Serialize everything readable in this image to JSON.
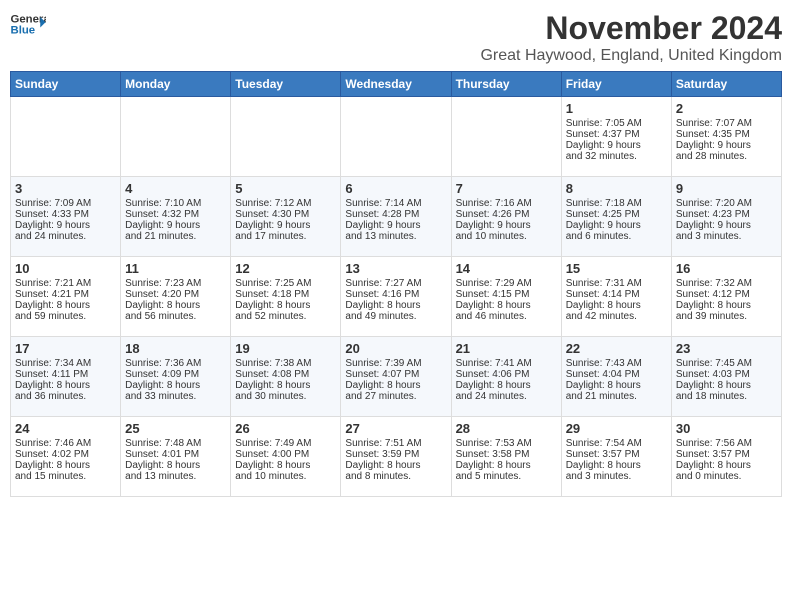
{
  "logo": {
    "line1": "General",
    "line2": "Blue"
  },
  "title": "November 2024",
  "location": "Great Haywood, England, United Kingdom",
  "weekdays": [
    "Sunday",
    "Monday",
    "Tuesday",
    "Wednesday",
    "Thursday",
    "Friday",
    "Saturday"
  ],
  "weeks": [
    [
      {
        "day": "",
        "info": ""
      },
      {
        "day": "",
        "info": ""
      },
      {
        "day": "",
        "info": ""
      },
      {
        "day": "",
        "info": ""
      },
      {
        "day": "",
        "info": ""
      },
      {
        "day": "1",
        "info": "Sunrise: 7:05 AM\nSunset: 4:37 PM\nDaylight: 9 hours\nand 32 minutes."
      },
      {
        "day": "2",
        "info": "Sunrise: 7:07 AM\nSunset: 4:35 PM\nDaylight: 9 hours\nand 28 minutes."
      }
    ],
    [
      {
        "day": "3",
        "info": "Sunrise: 7:09 AM\nSunset: 4:33 PM\nDaylight: 9 hours\nand 24 minutes."
      },
      {
        "day": "4",
        "info": "Sunrise: 7:10 AM\nSunset: 4:32 PM\nDaylight: 9 hours\nand 21 minutes."
      },
      {
        "day": "5",
        "info": "Sunrise: 7:12 AM\nSunset: 4:30 PM\nDaylight: 9 hours\nand 17 minutes."
      },
      {
        "day": "6",
        "info": "Sunrise: 7:14 AM\nSunset: 4:28 PM\nDaylight: 9 hours\nand 13 minutes."
      },
      {
        "day": "7",
        "info": "Sunrise: 7:16 AM\nSunset: 4:26 PM\nDaylight: 9 hours\nand 10 minutes."
      },
      {
        "day": "8",
        "info": "Sunrise: 7:18 AM\nSunset: 4:25 PM\nDaylight: 9 hours\nand 6 minutes."
      },
      {
        "day": "9",
        "info": "Sunrise: 7:20 AM\nSunset: 4:23 PM\nDaylight: 9 hours\nand 3 minutes."
      }
    ],
    [
      {
        "day": "10",
        "info": "Sunrise: 7:21 AM\nSunset: 4:21 PM\nDaylight: 8 hours\nand 59 minutes."
      },
      {
        "day": "11",
        "info": "Sunrise: 7:23 AM\nSunset: 4:20 PM\nDaylight: 8 hours\nand 56 minutes."
      },
      {
        "day": "12",
        "info": "Sunrise: 7:25 AM\nSunset: 4:18 PM\nDaylight: 8 hours\nand 52 minutes."
      },
      {
        "day": "13",
        "info": "Sunrise: 7:27 AM\nSunset: 4:16 PM\nDaylight: 8 hours\nand 49 minutes."
      },
      {
        "day": "14",
        "info": "Sunrise: 7:29 AM\nSunset: 4:15 PM\nDaylight: 8 hours\nand 46 minutes."
      },
      {
        "day": "15",
        "info": "Sunrise: 7:31 AM\nSunset: 4:14 PM\nDaylight: 8 hours\nand 42 minutes."
      },
      {
        "day": "16",
        "info": "Sunrise: 7:32 AM\nSunset: 4:12 PM\nDaylight: 8 hours\nand 39 minutes."
      }
    ],
    [
      {
        "day": "17",
        "info": "Sunrise: 7:34 AM\nSunset: 4:11 PM\nDaylight: 8 hours\nand 36 minutes."
      },
      {
        "day": "18",
        "info": "Sunrise: 7:36 AM\nSunset: 4:09 PM\nDaylight: 8 hours\nand 33 minutes."
      },
      {
        "day": "19",
        "info": "Sunrise: 7:38 AM\nSunset: 4:08 PM\nDaylight: 8 hours\nand 30 minutes."
      },
      {
        "day": "20",
        "info": "Sunrise: 7:39 AM\nSunset: 4:07 PM\nDaylight: 8 hours\nand 27 minutes."
      },
      {
        "day": "21",
        "info": "Sunrise: 7:41 AM\nSunset: 4:06 PM\nDaylight: 8 hours\nand 24 minutes."
      },
      {
        "day": "22",
        "info": "Sunrise: 7:43 AM\nSunset: 4:04 PM\nDaylight: 8 hours\nand 21 minutes."
      },
      {
        "day": "23",
        "info": "Sunrise: 7:45 AM\nSunset: 4:03 PM\nDaylight: 8 hours\nand 18 minutes."
      }
    ],
    [
      {
        "day": "24",
        "info": "Sunrise: 7:46 AM\nSunset: 4:02 PM\nDaylight: 8 hours\nand 15 minutes."
      },
      {
        "day": "25",
        "info": "Sunrise: 7:48 AM\nSunset: 4:01 PM\nDaylight: 8 hours\nand 13 minutes."
      },
      {
        "day": "26",
        "info": "Sunrise: 7:49 AM\nSunset: 4:00 PM\nDaylight: 8 hours\nand 10 minutes."
      },
      {
        "day": "27",
        "info": "Sunrise: 7:51 AM\nSunset: 3:59 PM\nDaylight: 8 hours\nand 8 minutes."
      },
      {
        "day": "28",
        "info": "Sunrise: 7:53 AM\nSunset: 3:58 PM\nDaylight: 8 hours\nand 5 minutes."
      },
      {
        "day": "29",
        "info": "Sunrise: 7:54 AM\nSunset: 3:57 PM\nDaylight: 8 hours\nand 3 minutes."
      },
      {
        "day": "30",
        "info": "Sunrise: 7:56 AM\nSunset: 3:57 PM\nDaylight: 8 hours\nand 0 minutes."
      }
    ]
  ]
}
